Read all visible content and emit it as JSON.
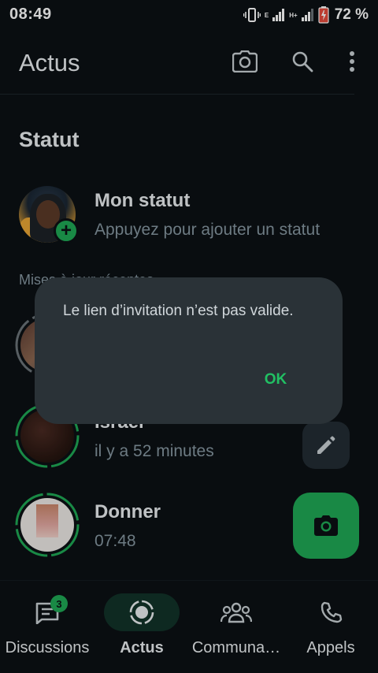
{
  "status_bar": {
    "time": "08:49",
    "network_1": "E",
    "network_2": "H+",
    "battery": "72 %"
  },
  "header": {
    "title": "Actus",
    "icons": [
      "camera-icon",
      "search-icon",
      "more-vert-icon"
    ]
  },
  "status": {
    "section_title": "Statut",
    "my_status": {
      "name": "Mon statut",
      "subtitle": "Appuyez pour ajouter un statut"
    },
    "recent_label": "Mises à jour récentes",
    "updates": [
      {
        "name": "",
        "time": ""
      },
      {
        "name": "Israel",
        "time": "il y a 52 minutes"
      },
      {
        "name": "Donner",
        "time": "07:48"
      }
    ]
  },
  "dialog": {
    "message": "Le lien d’invitation n’est pas valide.",
    "ok_label": "OK"
  },
  "bottom_nav": {
    "items": [
      {
        "label": "Discussions",
        "icon": "chat-icon",
        "badge": "3"
      },
      {
        "label": "Actus",
        "icon": "status-icon",
        "active": true
      },
      {
        "label": "Communa…",
        "icon": "communities-icon"
      },
      {
        "label": "Appels",
        "icon": "phone-icon"
      }
    ]
  },
  "colors": {
    "background": "#0b1014",
    "accent": "#1fa855",
    "dialog": "#2a3237",
    "text_secondary": "#8696a0"
  }
}
